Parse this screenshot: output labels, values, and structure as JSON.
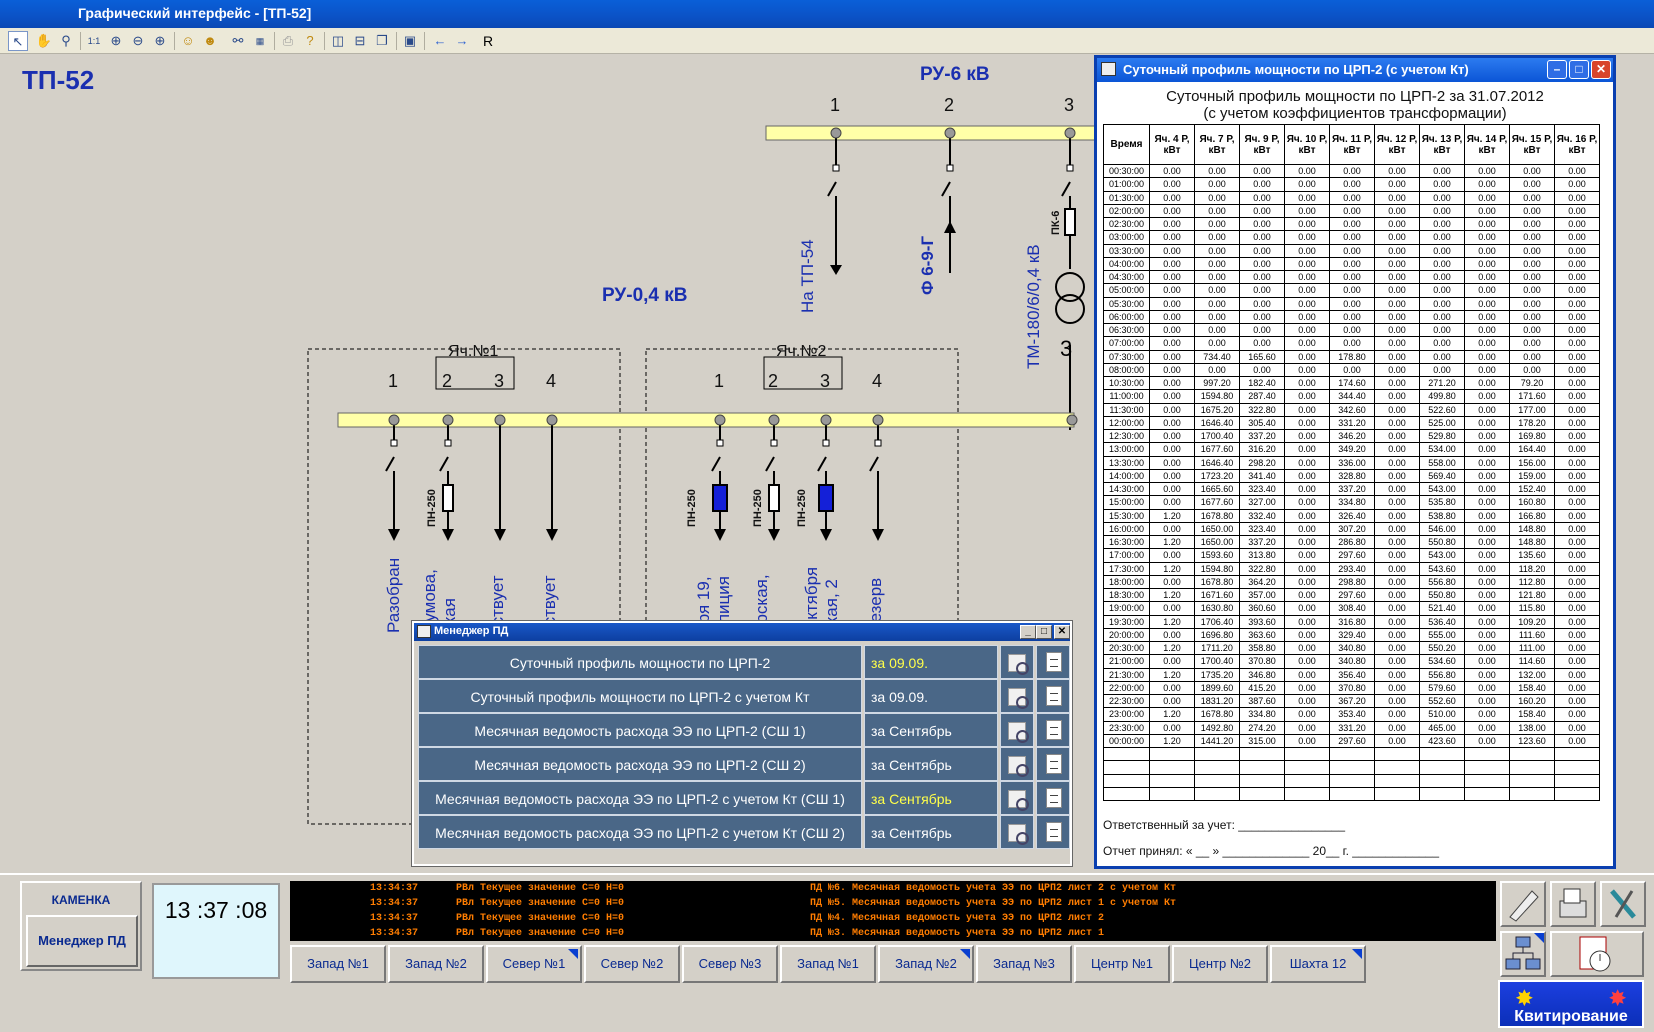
{
  "app": {
    "title": "Графический интерфейс - [ТП-52]"
  },
  "toolbar": {
    "r_label": "R"
  },
  "scheme": {
    "title": "ТП-52",
    "ru6": "РУ-6 кВ",
    "ru04": "РУ-0,4 кВ",
    "top_numbers": [
      "1",
      "2",
      "3"
    ],
    "cell1": "Яч.№1",
    "cell2": "Яч.№2",
    "cell1_numbers": [
      "1",
      "2",
      "3",
      "4"
    ],
    "cell2_numbers": [
      "1",
      "2",
      "3",
      "4"
    ],
    "feeder_tp54": "На ТП-54",
    "feeder_f69": "Ф 6-9-Г",
    "transformer": "ТМ-180/6/0,4 кВ",
    "fuse_pk6": "ПК-6",
    "fuse_pn250": "ПН-250",
    "out_1_1": "Разобран",
    "out_1_2a": "Чумова,",
    "out_1_2b": "ская",
    "out_1_3": "тствует",
    "out_1_4": "тствует",
    "out_2_1a": "бря 19,",
    "out_2_1b": "олиция",
    "out_2_2a": "орская,",
    "out_2_2b": "\"",
    "out_2_3a": "Октября",
    "out_2_3b": "ская, 2",
    "out_2_4": "Резерв"
  },
  "report": {
    "window_title": "Суточный профиль мощности по ЦРП-2 (с учетом Кт)",
    "heading1": "Суточный профиль мощности по ЦРП-2 за 31.07.2012",
    "heading2": "(с учетом коэффициентов трансформации)",
    "columns": [
      "Время",
      "Яч. 4 P, кВт",
      "Яч. 7 P, кВт",
      "Яч. 9 P, кВт",
      "Яч. 10 P, кВт",
      "Яч. 11 P, кВт",
      "Яч. 12 P, кВт",
      "Яч. 13 P, кВт",
      "Яч. 14 P, кВт",
      "Яч. 15 P, кВт",
      "Яч. 16 P, кВт"
    ],
    "rows": [
      [
        "00:30:00",
        "0.00",
        "0.00",
        "0.00",
        "0.00",
        "0.00",
        "0.00",
        "0.00",
        "0.00",
        "0.00",
        "0.00"
      ],
      [
        "01:00:00",
        "0.00",
        "0.00",
        "0.00",
        "0.00",
        "0.00",
        "0.00",
        "0.00",
        "0.00",
        "0.00",
        "0.00"
      ],
      [
        "01:30:00",
        "0.00",
        "0.00",
        "0.00",
        "0.00",
        "0.00",
        "0.00",
        "0.00",
        "0.00",
        "0.00",
        "0.00"
      ],
      [
        "02:00:00",
        "0.00",
        "0.00",
        "0.00",
        "0.00",
        "0.00",
        "0.00",
        "0.00",
        "0.00",
        "0.00",
        "0.00"
      ],
      [
        "02:30:00",
        "0.00",
        "0.00",
        "0.00",
        "0.00",
        "0.00",
        "0.00",
        "0.00",
        "0.00",
        "0.00",
        "0.00"
      ],
      [
        "03:00:00",
        "0.00",
        "0.00",
        "0.00",
        "0.00",
        "0.00",
        "0.00",
        "0.00",
        "0.00",
        "0.00",
        "0.00"
      ],
      [
        "03:30:00",
        "0.00",
        "0.00",
        "0.00",
        "0.00",
        "0.00",
        "0.00",
        "0.00",
        "0.00",
        "0.00",
        "0.00"
      ],
      [
        "04:00:00",
        "0.00",
        "0.00",
        "0.00",
        "0.00",
        "0.00",
        "0.00",
        "0.00",
        "0.00",
        "0.00",
        "0.00"
      ],
      [
        "04:30:00",
        "0.00",
        "0.00",
        "0.00",
        "0.00",
        "0.00",
        "0.00",
        "0.00",
        "0.00",
        "0.00",
        "0.00"
      ],
      [
        "05:00:00",
        "0.00",
        "0.00",
        "0.00",
        "0.00",
        "0.00",
        "0.00",
        "0.00",
        "0.00",
        "0.00",
        "0.00"
      ],
      [
        "05:30:00",
        "0.00",
        "0.00",
        "0.00",
        "0.00",
        "0.00",
        "0.00",
        "0.00",
        "0.00",
        "0.00",
        "0.00"
      ],
      [
        "06:00:00",
        "0.00",
        "0.00",
        "0.00",
        "0.00",
        "0.00",
        "0.00",
        "0.00",
        "0.00",
        "0.00",
        "0.00"
      ],
      [
        "06:30:00",
        "0.00",
        "0.00",
        "0.00",
        "0.00",
        "0.00",
        "0.00",
        "0.00",
        "0.00",
        "0.00",
        "0.00"
      ],
      [
        "07:00:00",
        "0.00",
        "0.00",
        "0.00",
        "0.00",
        "0.00",
        "0.00",
        "0.00",
        "0.00",
        "0.00",
        "0.00"
      ],
      [
        "07:30:00",
        "0.00",
        "734.40",
        "165.60",
        "0.00",
        "178.80",
        "0.00",
        "0.00",
        "0.00",
        "0.00",
        "0.00"
      ],
      [
        "08:00:00",
        "0.00",
        "0.00",
        "0.00",
        "0.00",
        "0.00",
        "0.00",
        "0.00",
        "0.00",
        "0.00",
        "0.00"
      ],
      [
        "10:30:00",
        "0.00",
        "997.20",
        "182.40",
        "0.00",
        "174.60",
        "0.00",
        "271.20",
        "0.00",
        "79.20",
        "0.00"
      ],
      [
        "11:00:00",
        "0.00",
        "1594.80",
        "287.40",
        "0.00",
        "344.40",
        "0.00",
        "499.80",
        "0.00",
        "171.60",
        "0.00"
      ],
      [
        "11:30:00",
        "0.00",
        "1675.20",
        "322.80",
        "0.00",
        "342.60",
        "0.00",
        "522.60",
        "0.00",
        "177.00",
        "0.00"
      ],
      [
        "12:00:00",
        "0.00",
        "1646.40",
        "305.40",
        "0.00",
        "331.20",
        "0.00",
        "525.00",
        "0.00",
        "178.20",
        "0.00"
      ],
      [
        "12:30:00",
        "0.00",
        "1700.40",
        "337.20",
        "0.00",
        "346.20",
        "0.00",
        "529.80",
        "0.00",
        "169.80",
        "0.00"
      ],
      [
        "13:00:00",
        "0.00",
        "1677.60",
        "316.20",
        "0.00",
        "349.20",
        "0.00",
        "534.00",
        "0.00",
        "164.40",
        "0.00"
      ],
      [
        "13:30:00",
        "0.00",
        "1646.40",
        "298.20",
        "0.00",
        "336.00",
        "0.00",
        "558.00",
        "0.00",
        "156.00",
        "0.00"
      ],
      [
        "14:00:00",
        "0.00",
        "1723.20",
        "341.40",
        "0.00",
        "328.80",
        "0.00",
        "569.40",
        "0.00",
        "159.00",
        "0.00"
      ],
      [
        "14:30:00",
        "0.00",
        "1665.60",
        "323.40",
        "0.00",
        "337.20",
        "0.00",
        "543.00",
        "0.00",
        "152.40",
        "0.00"
      ],
      [
        "15:00:00",
        "0.00",
        "1677.60",
        "327.00",
        "0.00",
        "334.80",
        "0.00",
        "535.80",
        "0.00",
        "160.80",
        "0.00"
      ],
      [
        "15:30:00",
        "1.20",
        "1678.80",
        "332.40",
        "0.00",
        "326.40",
        "0.00",
        "538.80",
        "0.00",
        "166.80",
        "0.00"
      ],
      [
        "16:00:00",
        "0.00",
        "1650.00",
        "323.40",
        "0.00",
        "307.20",
        "0.00",
        "546.00",
        "0.00",
        "148.80",
        "0.00"
      ],
      [
        "16:30:00",
        "1.20",
        "1650.00",
        "337.20",
        "0.00",
        "286.80",
        "0.00",
        "550.80",
        "0.00",
        "148.80",
        "0.00"
      ],
      [
        "17:00:00",
        "0.00",
        "1593.60",
        "313.80",
        "0.00",
        "297.60",
        "0.00",
        "543.00",
        "0.00",
        "135.60",
        "0.00"
      ],
      [
        "17:30:00",
        "1.20",
        "1594.80",
        "322.80",
        "0.00",
        "293.40",
        "0.00",
        "543.60",
        "0.00",
        "118.20",
        "0.00"
      ],
      [
        "18:00:00",
        "0.00",
        "1678.80",
        "364.20",
        "0.00",
        "298.80",
        "0.00",
        "556.80",
        "0.00",
        "112.80",
        "0.00"
      ],
      [
        "18:30:00",
        "1.20",
        "1671.60",
        "357.00",
        "0.00",
        "297.60",
        "0.00",
        "550.80",
        "0.00",
        "121.80",
        "0.00"
      ],
      [
        "19:00:00",
        "0.00",
        "1630.80",
        "360.60",
        "0.00",
        "308.40",
        "0.00",
        "521.40",
        "0.00",
        "115.80",
        "0.00"
      ],
      [
        "19:30:00",
        "1.20",
        "1706.40",
        "393.60",
        "0.00",
        "316.80",
        "0.00",
        "536.40",
        "0.00",
        "109.20",
        "0.00"
      ],
      [
        "20:00:00",
        "0.00",
        "1696.80",
        "363.60",
        "0.00",
        "329.40",
        "0.00",
        "555.00",
        "0.00",
        "111.60",
        "0.00"
      ],
      [
        "20:30:00",
        "1.20",
        "1711.20",
        "358.80",
        "0.00",
        "340.80",
        "0.00",
        "550.20",
        "0.00",
        "111.00",
        "0.00"
      ],
      [
        "21:00:00",
        "0.00",
        "1700.40",
        "370.80",
        "0.00",
        "340.80",
        "0.00",
        "534.60",
        "0.00",
        "114.60",
        "0.00"
      ],
      [
        "21:30:00",
        "1.20",
        "1735.20",
        "346.80",
        "0.00",
        "356.40",
        "0.00",
        "556.80",
        "0.00",
        "132.00",
        "0.00"
      ],
      [
        "22:00:00",
        "0.00",
        "1899.60",
        "415.20",
        "0.00",
        "370.80",
        "0.00",
        "579.60",
        "0.00",
        "158.40",
        "0.00"
      ],
      [
        "22:30:00",
        "0.00",
        "1831.20",
        "387.60",
        "0.00",
        "367.20",
        "0.00",
        "552.60",
        "0.00",
        "160.20",
        "0.00"
      ],
      [
        "23:00:00",
        "1.20",
        "1678.80",
        "334.80",
        "0.00",
        "353.40",
        "0.00",
        "510.00",
        "0.00",
        "158.40",
        "0.00"
      ],
      [
        "23:30:00",
        "0.00",
        "1492.80",
        "274.20",
        "0.00",
        "331.20",
        "0.00",
        "465.00",
        "0.00",
        "138.00",
        "0.00"
      ],
      [
        "00:00:00",
        "1.20",
        "1441.20",
        "315.00",
        "0.00",
        "297.60",
        "0.00",
        "423.60",
        "0.00",
        "123.60",
        "0.00"
      ]
    ],
    "empty_rows": 4,
    "footer1": "Ответственный за учет:  ________________",
    "footer2": "Отчет принял: « __ »  _____________ 20__ г.  _____________"
  },
  "manager": {
    "title": "Менеджер ПД",
    "items": [
      {
        "name": "Суточный профиль мощности по ЦРП-2",
        "date": "за 09.09.",
        "highlight": true
      },
      {
        "name": "Суточный профиль мощности по ЦРП-2 с учетом Кт",
        "date": "за 09.09.",
        "highlight": false
      },
      {
        "name": "Месячная ведомость расхода ЭЭ по ЦРП-2 (СШ 1)",
        "date": "за Сентябрь",
        "highlight": false
      },
      {
        "name": "Месячная ведомость расхода ЭЭ по ЦРП-2 (СШ 2)",
        "date": "за Сентябрь",
        "highlight": false
      },
      {
        "name": "Месячная ведомость расхода ЭЭ по ЦРП-2 с учетом Кт (СШ 1)",
        "date": "за Сентябрь",
        "highlight": true
      },
      {
        "name": "Месячная ведомость расхода ЭЭ по ЦРП-2 с учетом Кт (СШ 2)",
        "date": "за Сентябрь",
        "highlight": false
      }
    ]
  },
  "bottom": {
    "site": "КАМЕНКА",
    "manager_button": "Менеджер ПД",
    "clock": "13 :37 :08",
    "log": [
      {
        "time": "13:34:37",
        "event": "РВл Текущее значение С=0 Н=0",
        "report": "ПД №6. Месячная ведомость учета ЭЭ по ЦРП2 лист 2 с учетом Кт"
      },
      {
        "time": "13:34:37",
        "event": "РВл Текущее значение С=0 Н=0",
        "report": "ПД №5. Месячная ведомость учета ЭЭ по ЦРП2 лист 1 с учетом Кт"
      },
      {
        "time": "13:34:37",
        "event": "РВл Текущее значение С=0 Н=0",
        "report": "ПД №4. Месячная ведомость учета ЭЭ по ЦРП2 лист 2"
      },
      {
        "time": "13:34:37",
        "event": "РВл Текущее значение С=0 Н=0",
        "report": "ПД №3. Месячная ведомость учета ЭЭ по ЦРП2 лист 1"
      }
    ],
    "zones": [
      {
        "label": "Запад №1",
        "flag": false
      },
      {
        "label": "Запад №2",
        "flag": false
      },
      {
        "label": "Север №1",
        "flag": true
      },
      {
        "label": "Север №2",
        "flag": false
      },
      {
        "label": "Север №3",
        "flag": false
      },
      {
        "label": "Запад №1",
        "flag": false
      },
      {
        "label": "Запад №2",
        "flag": true
      },
      {
        "label": "Запад №3",
        "flag": false
      },
      {
        "label": "Центр №1",
        "flag": false
      },
      {
        "label": "Центр №2",
        "flag": false
      },
      {
        "label": "Шахта 12",
        "flag": true
      }
    ],
    "kvit": "Квитирование"
  }
}
